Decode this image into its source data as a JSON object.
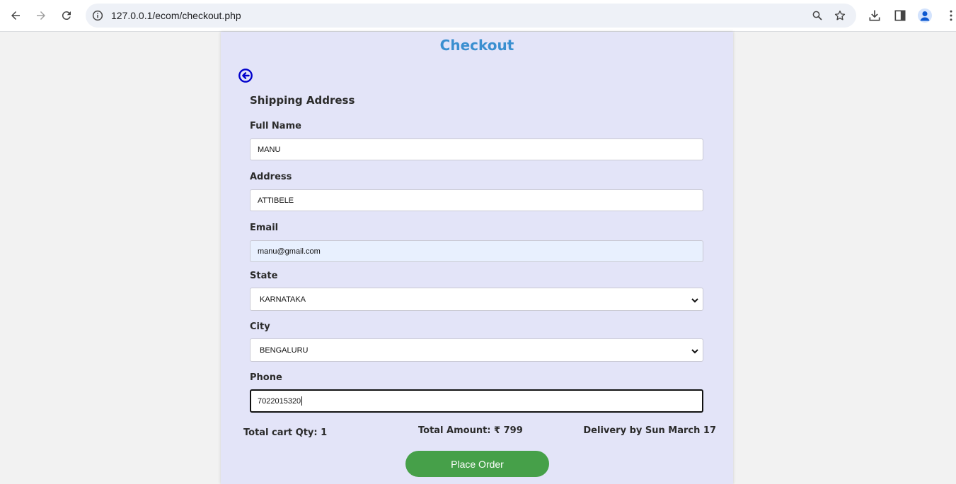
{
  "browser": {
    "url": "127.0.0.1/ecom/checkout.php"
  },
  "page": {
    "title": "Checkout",
    "section_title": "Shipping Address",
    "accent_color": "#3a8fd0",
    "back_icon": "circle-arrow-left-icon"
  },
  "form": {
    "full_name": {
      "label": "Full Name",
      "value": "MANU"
    },
    "address": {
      "label": "Address",
      "value": "ATTIBELE"
    },
    "email": {
      "label": "Email",
      "value": "manu@gmail.com"
    },
    "state": {
      "label": "State",
      "value": "KARNATAKA"
    },
    "city": {
      "label": "City",
      "value": "BENGALURU"
    },
    "phone": {
      "label": "Phone",
      "value": "7022015320"
    }
  },
  "summary": {
    "cart_qty": "Total cart Qty: 1",
    "total_amount": "Total Amount: ₹ 799",
    "delivery": "Delivery by Sun March 17"
  },
  "actions": {
    "place_order": "Place Order",
    "button_color": "#46a049"
  }
}
